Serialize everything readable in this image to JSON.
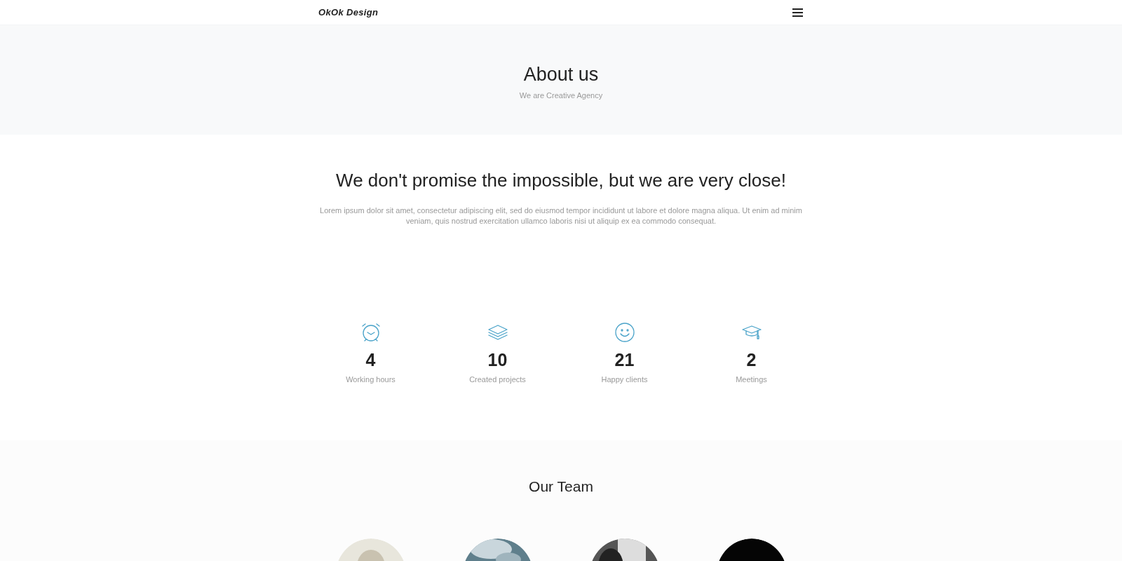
{
  "navbar": {
    "brand": "OkOk Design"
  },
  "hero": {
    "title": "About us",
    "subtitle": "We are Creative Agency"
  },
  "intro": {
    "heading": "We don't promise the impossible, but we are very close!",
    "text": "Lorem ipsum dolor sit amet, consectetur adipiscing elit, sed do eiusmod tempor incididunt ut labore et dolore magna aliqua. Ut enim ad minim veniam, quis nostrud exercitation ullamco laboris nisi ut aliquip ex ea commodo consequat."
  },
  "stats": [
    {
      "value": "4",
      "label": "Working hours"
    },
    {
      "value": "10",
      "label": "Created projects"
    },
    {
      "value": "21",
      "label": "Happy clients"
    },
    {
      "value": "2",
      "label": "Meetings"
    }
  ],
  "team": {
    "title": "Our Team"
  }
}
